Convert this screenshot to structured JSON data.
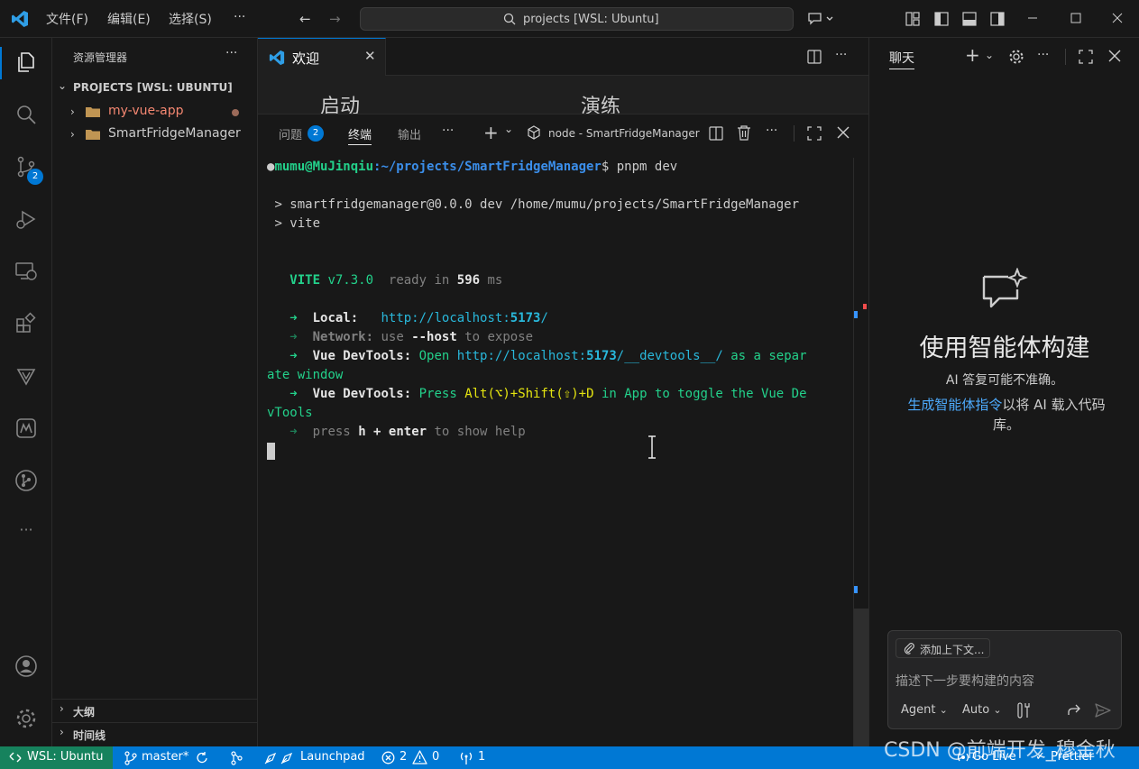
{
  "titlebar": {
    "menus": [
      "文件(F)",
      "编辑(E)",
      "选择(S)"
    ],
    "more": "···",
    "search_text": "projects [WSL: Ubuntu]"
  },
  "activity": {
    "source_control_badge": "2"
  },
  "sidebar": {
    "header": "资源管理器",
    "more": "···",
    "section": "PROJECTS [WSL: UBUNTU]",
    "items": [
      {
        "label": "my-vue-app",
        "color": "#f48771",
        "modified": true
      },
      {
        "label": "SmartFridgeManager",
        "color": "#cccccc",
        "modified": false
      }
    ],
    "outline": "大纲",
    "timeline": "时间线"
  },
  "editor": {
    "tab_label": "欢迎",
    "welcome_start": "启动",
    "welcome_walkthrough": "演练"
  },
  "panel": {
    "tabs": {
      "problems": "问题",
      "problems_badge": "2",
      "terminal": "终端",
      "output": "输出"
    },
    "terminal_name": "node - SmartFridgeManager"
  },
  "terminal": {
    "prompt_user": "mumu@MuJinqiu",
    "prompt_path": ":~/projects/SmartFridgeManager",
    "prompt_cmd": "$ pnpm dev",
    "line1": "> smartfridgemanager@0.0.0 dev /home/mumu/projects/SmartFridgeManager",
    "line2": "> vite",
    "vite": "VITE",
    "vite_ver": "v7.3.0",
    "ready": "ready in",
    "ready_ms": "596",
    "ms": "ms",
    "local_label": "Local:",
    "local_url_a": "http://localhost:",
    "local_port": "5173",
    "local_slash": "/",
    "network_label": "Network:",
    "network_use": "use",
    "network_host": "--host",
    "network_expose": "to expose",
    "devtools_label": "Vue DevTools:",
    "devtools_open": "Open",
    "devtools_url_a": "http://localhost:",
    "devtools_port": "5173",
    "devtools_url_b": "/__devtools__/",
    "devtools_as": "as a separ",
    "devtools_wrap": "ate window",
    "press_label": "Press",
    "press_keys": "Alt(⌥)+Shift(⇧)+D",
    "press_rest": "in App to toggle the Vue De",
    "press_wrap": "vTools",
    "help_press": "press",
    "help_h": "h + enter",
    "help_rest": "to show help"
  },
  "chat": {
    "title": "聊天",
    "heading": "使用智能体构建",
    "subtitle": "AI 答复可能不准确。",
    "hint_link": "生成智能体指令",
    "hint_rest": "以将 AI 载入代码库。",
    "add_context": "添加上下文...",
    "placeholder": "描述下一步要构建的内容",
    "agent": "Agent",
    "auto": "Auto"
  },
  "status": {
    "remote": "WSL: Ubuntu",
    "branch": "master*",
    "launchpad": "Launchpad",
    "errors": "2",
    "warnings": "0",
    "ports": "1",
    "golive": "Go Live",
    "prettier": "Prettier"
  },
  "watermark": "CSDN @前端开发_穆金秋"
}
